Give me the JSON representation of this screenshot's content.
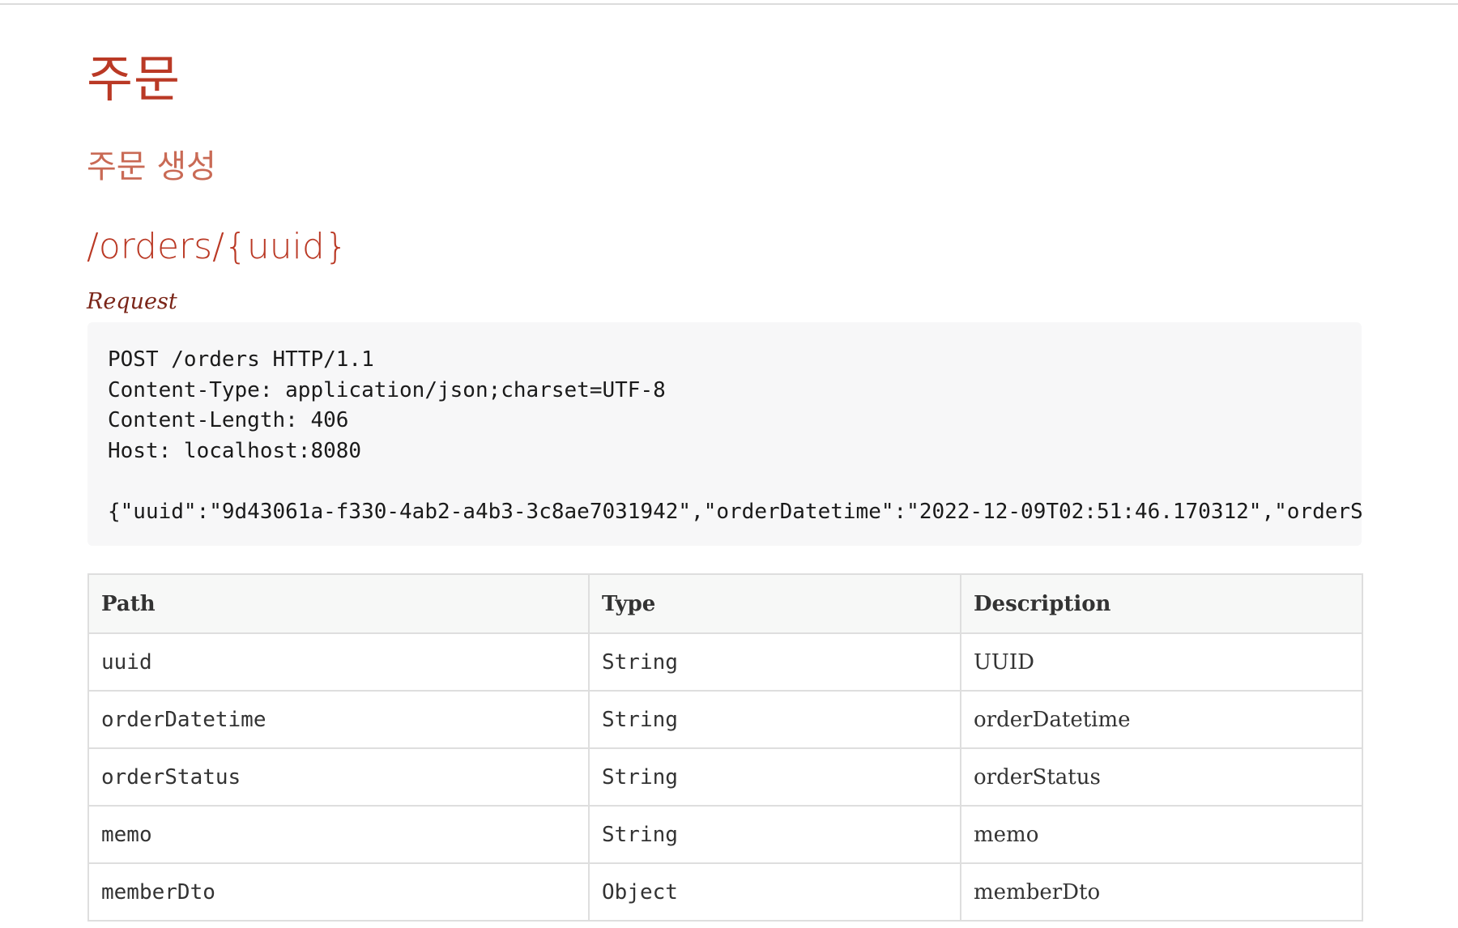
{
  "section": {
    "title": "주문",
    "subtitle": "주문 생성",
    "endpoint": "/orders/{uuid}"
  },
  "request": {
    "label": "Request",
    "lines": [
      "POST /orders HTTP/1.1",
      "Content-Type: application/json;charset=UTF-8",
      "Content-Length: 406",
      "Host: localhost:8080",
      "",
      "{\"uuid\":\"9d43061a-f330-4ab2-a4b3-3c8ae7031942\",\"orderDatetime\":\"2022-12-09T02:51:46.170312\",\"orderS"
    ]
  },
  "fields_table": {
    "headers": {
      "path": "Path",
      "type": "Type",
      "description": "Description"
    },
    "rows": [
      {
        "path": "uuid",
        "type": "String",
        "description": "UUID"
      },
      {
        "path": "orderDatetime",
        "type": "String",
        "description": "orderDatetime"
      },
      {
        "path": "orderStatus",
        "type": "String",
        "description": "orderStatus"
      },
      {
        "path": "memo",
        "type": "String",
        "description": "memo"
      },
      {
        "path": "memberDto",
        "type": "Object",
        "description": "memberDto"
      }
    ]
  }
}
